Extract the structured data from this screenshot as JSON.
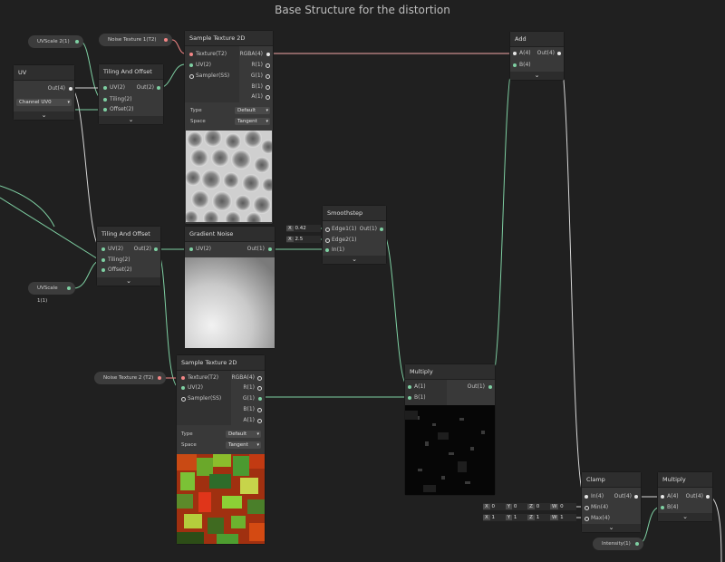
{
  "title": "Base Structure for the distortion",
  "props": {
    "uvscale2": "UVScale 2(1)",
    "noise1": "Noise Texture 1(T2)",
    "uvscale1": "UVScale 1(1)",
    "noise2": "Noise Texture 2 (T2)",
    "intensity": "Intensity(1)"
  },
  "uv": {
    "title": "UV",
    "out": "Out(4)",
    "channel_label": "Channel",
    "channel_value": "UV0"
  },
  "tiling1": {
    "title": "Tiling And Offset",
    "uv": "UV(2)",
    "tiling": "Tiling(2)",
    "offset": "Offset(2)",
    "out": "Out(2)"
  },
  "tiling2": {
    "title": "Tiling And Offset",
    "uv": "UV(2)",
    "tiling": "Tiling(2)",
    "offset": "Offset(2)",
    "out": "Out(2)"
  },
  "sample1": {
    "title": "Sample Texture 2D",
    "tex": "Texture(T2)",
    "uv": "UV(2)",
    "sampler": "Sampler(SS)",
    "rgba": "RGBA(4)",
    "r": "R(1)",
    "g": "G(1)",
    "b": "B(1)",
    "a": "A(1)",
    "type_label": "Type",
    "type_value": "Default",
    "space_label": "Space",
    "space_value": "Tangent"
  },
  "sample2": {
    "title": "Sample Texture 2D",
    "tex": "Texture(T2)",
    "uv": "UV(2)",
    "sampler": "Sampler(SS)",
    "rgba": "RGBA(4)",
    "r": "R(1)",
    "g": "G(1)",
    "b": "B(1)",
    "a": "A(1)",
    "type_label": "Type",
    "type_value": "Default",
    "space_label": "Space",
    "space_value": "Tangent"
  },
  "gradient": {
    "title": "Gradient Noise",
    "uv": "UV(2)",
    "out": "Out(1)"
  },
  "smooth": {
    "title": "Smoothstep",
    "e1": "Edge1(1)",
    "e2": "Edge2(1)",
    "in": "In(1)",
    "out": "Out(1)",
    "x1_axis": "X",
    "x1_val": "0.42",
    "x2_axis": "X",
    "x2_val": "2.5"
  },
  "multiply1": {
    "title": "Multiply",
    "a": "A(1)",
    "b": "B(1)",
    "out": "Out(1)"
  },
  "add": {
    "title": "Add",
    "a": "A(4)",
    "b": "B(4)",
    "out": "Out(4)"
  },
  "clamp": {
    "title": "Clamp",
    "in": "In(4)",
    "min": "Min(4)",
    "max": "Max(4)",
    "out": "Out(4)"
  },
  "multiply2": {
    "title": "Multiply",
    "a": "A(4)",
    "b": "B(4)",
    "out": "Out(4)"
  },
  "min_vals": {
    "x_axis": "X",
    "x": "0",
    "y_axis": "Y",
    "y": "0",
    "z_axis": "Z",
    "z": "0",
    "w_axis": "W",
    "w": "0"
  },
  "max_vals": {
    "x_axis": "X",
    "x": "1",
    "y_axis": "Y",
    "y": "1",
    "z_axis": "Z",
    "z": "1",
    "w_axis": "W",
    "w": "1"
  },
  "chev": "⌄",
  "colors": {
    "wire_green": "#7ecfa2",
    "wire_white": "#d6d6d6",
    "wire_red": "#f38686",
    "bg": "#202020",
    "node": "#393939"
  }
}
